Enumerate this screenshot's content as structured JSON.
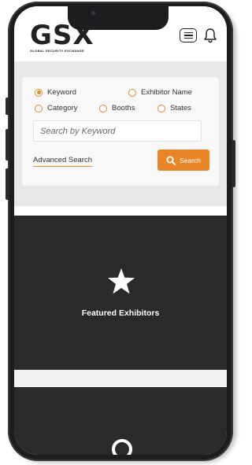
{
  "app": {
    "logo_text": "GSX",
    "logo_subtitle": "GLOBAL SECURITY EXCHANGE"
  },
  "header": {
    "menu_icon": "hamburger-menu-icon",
    "notification_icon": "bell-icon"
  },
  "search": {
    "options": [
      {
        "label": "Keyword",
        "selected": true
      },
      {
        "label": "Exhibitor Name",
        "selected": false
      },
      {
        "label": "Category",
        "selected": false
      },
      {
        "label": "Booths",
        "selected": false
      },
      {
        "label": "States",
        "selected": false
      }
    ],
    "placeholder": "Search by Keyword",
    "advanced_label": "Advanced Search",
    "button_label": "Search",
    "accent_color": "#e88526"
  },
  "featured": {
    "label": "Featured Exhibitors",
    "icon": "star-icon"
  },
  "next_section": {
    "icon": "ring-icon"
  }
}
